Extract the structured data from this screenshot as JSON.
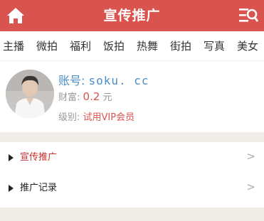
{
  "header": {
    "title": "宣传推广"
  },
  "categories": [
    "主播",
    "微拍",
    "福利",
    "饭拍",
    "热舞",
    "街拍",
    "写真",
    "美女"
  ],
  "profile": {
    "account_label": "账号:",
    "account_value": "soku. cc",
    "wealth_label": "财富:",
    "wealth_value": "0.2",
    "wealth_unit": "元",
    "level_label": "级别:",
    "level_value": "试用VIP会员"
  },
  "menu": [
    {
      "label": "宣传推广",
      "color": "#c9302c",
      "arrow": ">"
    },
    {
      "label": "推广记录",
      "color": "#222222",
      "arrow": ">"
    }
  ],
  "colors": {
    "accent": "#d9534f",
    "link": "#4a8ec7"
  }
}
